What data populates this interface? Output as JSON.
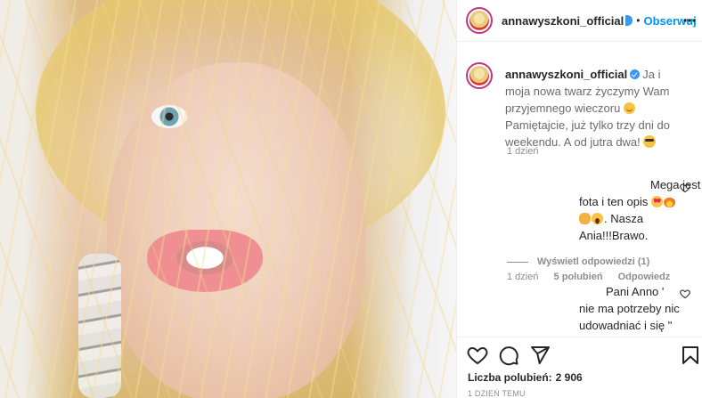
{
  "post": {
    "username": "annawyszkoni_official",
    "dot": "•",
    "follow_label": "Obserwuj"
  },
  "caption": {
    "username": "annawyszkoni_official",
    "text_a": "Ja i moja nowa twarz życzymy Wam przyjemnego wieczoru",
    "text_b": "Pamiętajcie, już tylko trzy dni do weekendu. A od jutra dwa!",
    "time": "1 dzień"
  },
  "comments": [
    {
      "line1": "Mega jest ta",
      "line2_a": "fota i ten opis",
      "line2_b": ". Nasza Ania!!!Brawo.",
      "time": "1 dzień",
      "likes": "5 polubień",
      "reply": "Odpowiedz"
    },
    {
      "line1": "Pani Anno '",
      "rest": "nie ma potrzeby nic udowadniać i się \" tłumaczyć. Rozumiem , że to odpowiedź na te okropne"
    }
  ],
  "view_replies": "Wyświetl odpowiedzi (1)",
  "footer": {
    "likes_label": "Liczba polubień:",
    "likes_count": "2 906",
    "date": "1 dzień temu"
  },
  "icons": {
    "more": "more-horizontal-icon",
    "like": "heart-icon",
    "comment": "comment-icon",
    "share": "paper-plane-icon",
    "save": "bookmark-icon"
  },
  "colors": {
    "follow": "#0095f6",
    "verified": "#3897f0",
    "story_ring": "#c13584"
  }
}
